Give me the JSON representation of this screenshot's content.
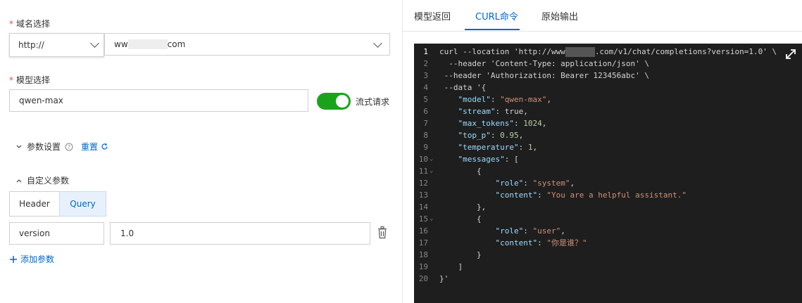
{
  "left": {
    "domain_label": "域名选择",
    "protocol_value": "http://",
    "domain_prefix": "ww",
    "domain_suffix": "com",
    "model_label": "模型选择",
    "model_value": "qwen-max",
    "stream_label": "流式请求",
    "params_label": "参数设置",
    "reset_label": "重置",
    "custom_label": "自定义参数",
    "tab_header": "Header",
    "tab_query": "Query",
    "param_key": "version",
    "param_value": "1.0",
    "add_param_label": "添加参数"
  },
  "right": {
    "tabs": [
      "模型返回",
      "CURL命令",
      "原始输出"
    ],
    "active_tab": "CURL命令"
  },
  "code": {
    "line_numbers": [
      "1",
      "2",
      "3",
      "4",
      "5",
      "6",
      "7",
      "8",
      "9",
      "10",
      "11",
      "12",
      "13",
      "14",
      "15",
      "16",
      "17",
      "18",
      "19",
      "20"
    ],
    "l1a": "curl --location 'http://www",
    "l1b": ".com/v1/chat/completions?version=1.0' \\",
    "l2": "  --header 'Content-Type: application/json' \\",
    "l3": " --header 'Authorization: Bearer 123456abc' \\",
    "l4": " --data '{",
    "l5k": "\"model\"",
    "l5v": "\"qwen-max\"",
    "l6k": "\"stream\"",
    "l6v": "true",
    "l7k": "\"max_tokens\"",
    "l7v": "1024",
    "l8k": "\"top_p\"",
    "l8v": "0.95",
    "l9k": "\"temperature\"",
    "l9v": "1",
    "l10k": "\"messages\"",
    "l10v": "[",
    "l11": "{",
    "l12k": "\"role\"",
    "l12v": "\"system\"",
    "l13k": "\"content\"",
    "l13v": "\"You are a helpful assistant.\"",
    "l14": "},",
    "l15": "{",
    "l16k": "\"role\"",
    "l16v": "\"user\"",
    "l17k": "\"content\"",
    "l17v": "\"你是谁？\"",
    "l18": "}",
    "l19": "]",
    "l20": "}'"
  },
  "colors": {
    "accent": "#0066cc",
    "toggle_on": "#1aa31a",
    "required": "#e34d4d",
    "editor_bg": "#1e1e1e"
  },
  "icons": [
    "chevron-down-icon",
    "help-circle-icon",
    "refresh-icon",
    "chevron-up-icon",
    "trash-icon",
    "plus-icon",
    "expand-icon"
  ]
}
